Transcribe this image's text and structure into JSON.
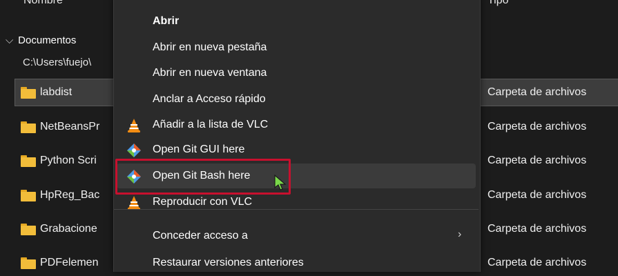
{
  "header": {
    "name_col": "Nombre",
    "type_col": "Tipo"
  },
  "group": {
    "name": "Documentos",
    "path": "C:\\Users\\fuejo\\"
  },
  "files": [
    {
      "name": "labdist",
      "type": "Carpeta de archivos",
      "selected": true
    },
    {
      "name": "NetBeansPr",
      "type": "Carpeta de archivos"
    },
    {
      "name": "Python Scri",
      "type": "Carpeta de archivos"
    },
    {
      "name": "HpReg_Bac",
      "type": "Carpeta de archivos"
    },
    {
      "name": "Grabacione",
      "type": "Carpeta de archivos"
    },
    {
      "name": "PDFelemen",
      "type": "Carpeta de archivos"
    }
  ],
  "menu": {
    "items": [
      {
        "label": "Abrir"
      },
      {
        "label": "Abrir en nueva pestaña"
      },
      {
        "label": "Abrir en nueva ventana"
      },
      {
        "label": "Anclar a Acceso rápido"
      },
      {
        "label": "Añadir a la lista de VLC",
        "icon": "vlc-icon"
      },
      {
        "label": "Open Git GUI here",
        "icon": "git-gui-icon"
      },
      {
        "label": "Open Git Bash here",
        "icon": "git-bash-icon"
      },
      {
        "label": "Reproducir con VLC",
        "icon": "vlc-icon"
      },
      {
        "label": "Conceder acceso a",
        "arrow": "›"
      },
      {
        "label": "Restaurar versiones anteriores"
      }
    ]
  },
  "colors": {
    "background": "#1c1c1c",
    "menu_bg": "#2b2b2b",
    "highlight_border": "#c8102e",
    "folder": "#f2bd3a",
    "cursor": "#7ad94a"
  }
}
